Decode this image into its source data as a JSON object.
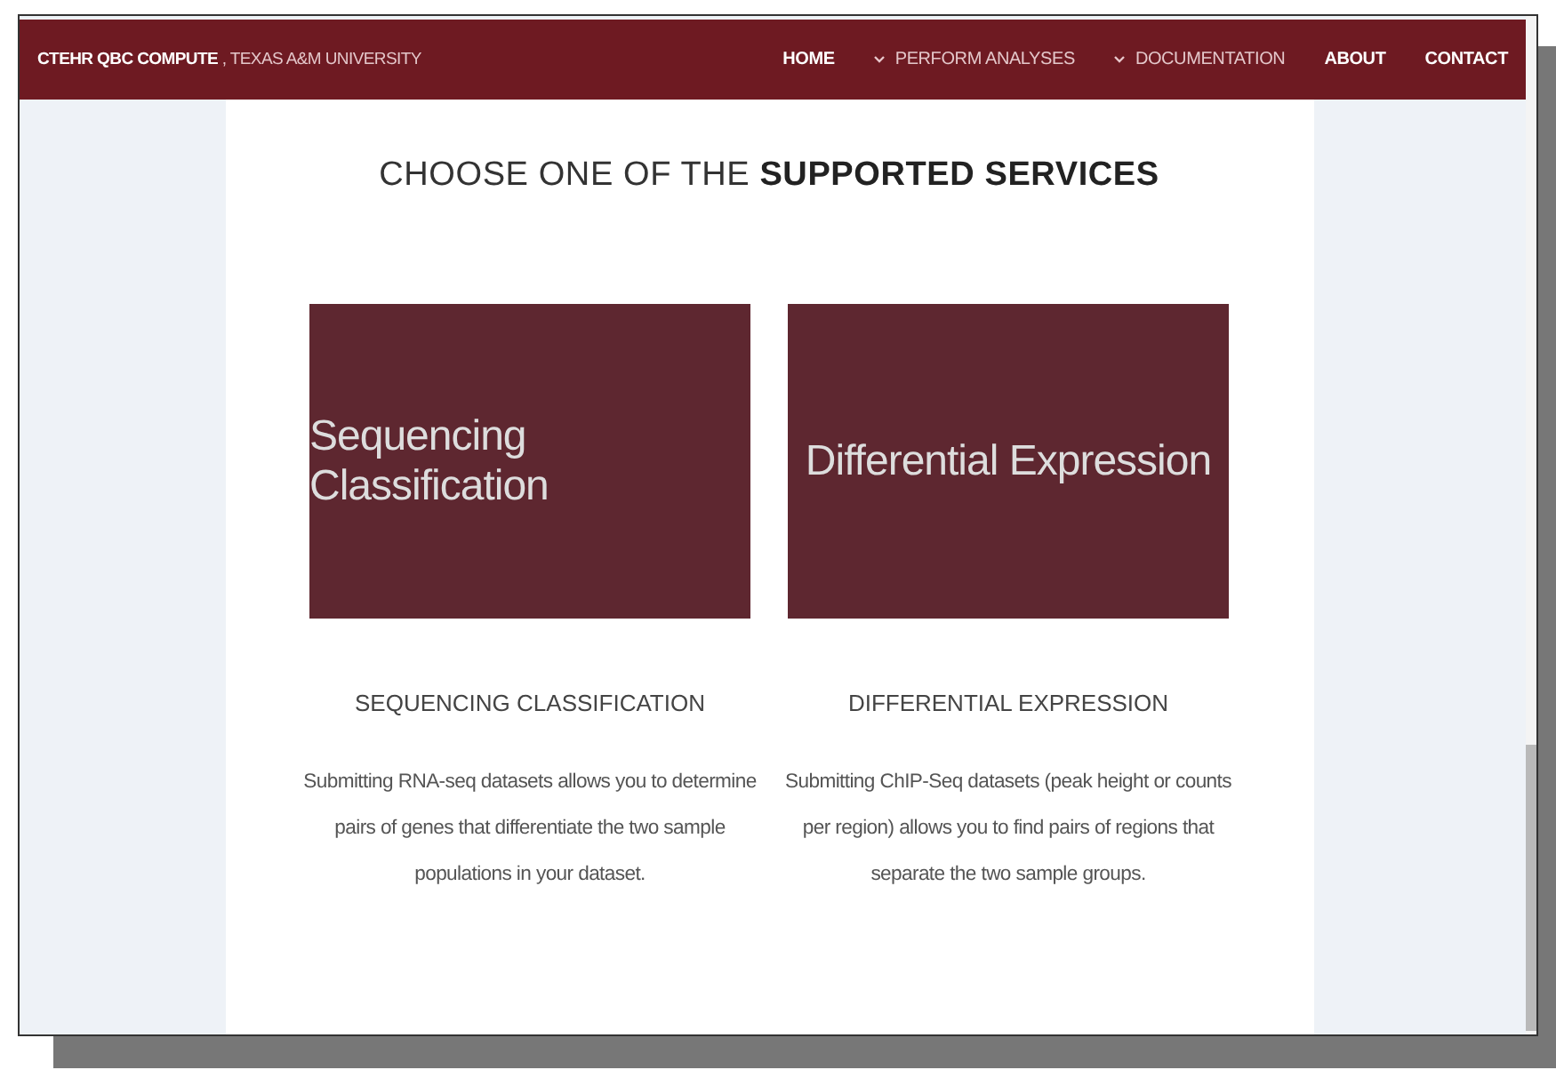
{
  "brand": {
    "name": "CTEHR QBC COMPUTE",
    "suffix": ", TEXAS A&M UNIVERSITY"
  },
  "nav": [
    {
      "label": "HOME",
      "kind": "link"
    },
    {
      "label": "PERFORM ANALYSES",
      "kind": "dropdown"
    },
    {
      "label": "DOCUMENTATION",
      "kind": "dropdown"
    },
    {
      "label": "ABOUT",
      "kind": "link"
    },
    {
      "label": "CONTACT",
      "kind": "link"
    }
  ],
  "heading": "CHOOSE ONE OF THE **SUPPORTED SERVICES**",
  "services": [
    {
      "tile": "Sequencing Classification",
      "title": "SEQUENCING CLASSIFICATION",
      "description": "Submitting RNA-seq datasets allows you to determine pairs of genes that differentiate the two sample populations in your dataset."
    },
    {
      "tile": "Differential Expression",
      "title": "DIFFERENTIAL EXPRESSION",
      "description": "Submitting ChIP-Seq datasets (peak height or counts per region) allows you to find pairs of regions that separate the two sample groups."
    }
  ]
}
